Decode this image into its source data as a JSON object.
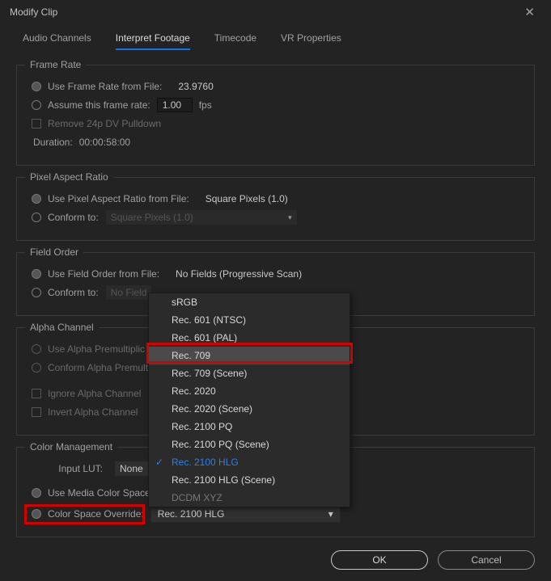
{
  "window": {
    "title": "Modify Clip"
  },
  "tabs": {
    "audio": "Audio Channels",
    "interpret": "Interpret Footage",
    "timecode": "Timecode",
    "vr": "VR Properties"
  },
  "frameRate": {
    "legend": "Frame Rate",
    "useFromFile": "Use Frame Rate from File:",
    "fileValue": "23.9760",
    "assume": "Assume this frame rate:",
    "assumeValue": "1.00",
    "fps": "fps",
    "removePulldown": "Remove 24p DV Pulldown",
    "durationLabel": "Duration:",
    "durationValue": "00:00:58:00"
  },
  "par": {
    "legend": "Pixel Aspect Ratio",
    "useFromFile": "Use Pixel Aspect Ratio from File:",
    "fileValue": "Square Pixels (1.0)",
    "conform": "Conform to:",
    "conformValue": "Square Pixels (1.0)"
  },
  "fieldOrder": {
    "legend": "Field Order",
    "useFromFile": "Use Field Order from File:",
    "fileValue": "No Fields (Progressive Scan)",
    "conform": "Conform to:",
    "conformValue": "No Field"
  },
  "alpha": {
    "legend": "Alpha Channel",
    "premult": "Use Alpha Premultiplic",
    "conform": "Conform Alpha Premulti",
    "ignore": "Ignore Alpha Channel",
    "invert": "Invert Alpha Channel"
  },
  "color": {
    "legend": "Color Management",
    "inputLut": "Input LUT:",
    "lutValue": "None",
    "useMedia": "Use Media Color Space f",
    "override": "Color Space Override:",
    "overrideValue": "Rec. 2100 HLG"
  },
  "dropdown": {
    "items": [
      "sRGB",
      "Rec. 601 (NTSC)",
      "Rec. 601 (PAL)",
      "Rec. 709",
      "Rec. 709 (Scene)",
      "Rec. 2020",
      "Rec. 2020 (Scene)",
      "Rec. 2100 PQ",
      "Rec. 2100 PQ (Scene)",
      "Rec. 2100 HLG",
      "Rec. 2100 HLG (Scene)",
      "DCDM XYZ"
    ]
  },
  "buttons": {
    "ok": "OK",
    "cancel": "Cancel"
  }
}
